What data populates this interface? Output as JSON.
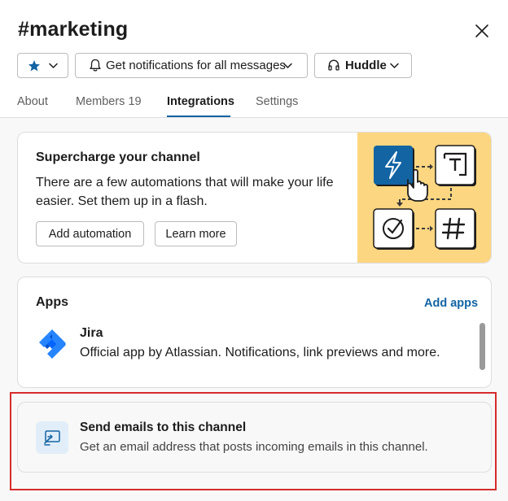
{
  "channel": {
    "hash": "#",
    "name": "marketing"
  },
  "header": {
    "notifications_label": "Get notifications for all messages",
    "huddle_label": "Huddle"
  },
  "tabs": [
    {
      "label": "About"
    },
    {
      "label": "Members 19"
    },
    {
      "label": "Integrations",
      "active": true
    },
    {
      "label": "Settings"
    }
  ],
  "promo": {
    "title": "Supercharge your channel",
    "text": "There are a few automations that will make your life easier. Set them up in a flash.",
    "add_automation_label": "Add automation",
    "learn_more_label": "Learn more"
  },
  "apps": {
    "title": "Apps",
    "add_apps_label": "Add apps",
    "items": [
      {
        "name": "Jira",
        "description": "Official app by Atlassian. Notifications, link previews and more.",
        "icon": "jira-icon"
      }
    ]
  },
  "email": {
    "title": "Send emails to this channel",
    "description": "Get an email address that posts incoming emails in this channel.",
    "icon": "email-forward-icon"
  },
  "colors": {
    "accent": "#1264a3",
    "promo_bg": "#fcd680",
    "highlight": "#d62c2c",
    "star": "#1264a3"
  }
}
